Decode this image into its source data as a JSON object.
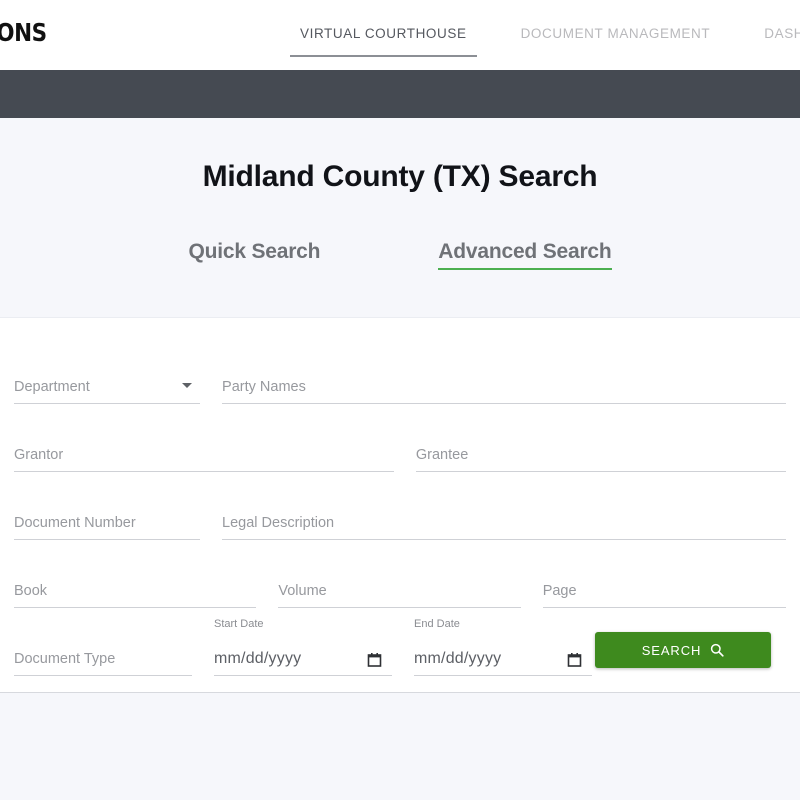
{
  "header": {
    "brand": "SOLUTIONS",
    "nav": [
      {
        "label": "VIRTUAL COURTHOUSE",
        "active": true
      },
      {
        "label": "DOCUMENT MANAGEMENT",
        "active": false
      },
      {
        "label": "DASHBOARD",
        "active": false
      }
    ],
    "accent_bar_color": "#454a52"
  },
  "hero": {
    "title": "Midland County (TX) Search",
    "tabs": [
      {
        "label": "Quick Search",
        "active": false
      },
      {
        "label": "Advanced Search",
        "active": true
      }
    ],
    "active_underline_color": "#4caf50"
  },
  "form": {
    "department": {
      "placeholder": "Department",
      "value": ""
    },
    "party_names": {
      "placeholder": "Party Names",
      "value": ""
    },
    "grantor": {
      "placeholder": "Grantor",
      "value": ""
    },
    "grantee": {
      "placeholder": "Grantee",
      "value": ""
    },
    "document_number": {
      "placeholder": "Document Number",
      "value": ""
    },
    "legal_description": {
      "placeholder": "Legal Description",
      "value": ""
    },
    "book": {
      "placeholder": "Book",
      "value": ""
    },
    "volume": {
      "placeholder": "Volume",
      "value": ""
    },
    "page": {
      "placeholder": "Page",
      "value": ""
    },
    "document_type": {
      "placeholder": "Document Type",
      "value": ""
    },
    "start_date": {
      "label": "Start Date",
      "value": "mm/dd/yyyy"
    },
    "end_date": {
      "label": "End Date",
      "value": "mm/dd/yyyy"
    },
    "search_button": {
      "label": "SEARCH",
      "color": "#3e8a1e"
    }
  }
}
